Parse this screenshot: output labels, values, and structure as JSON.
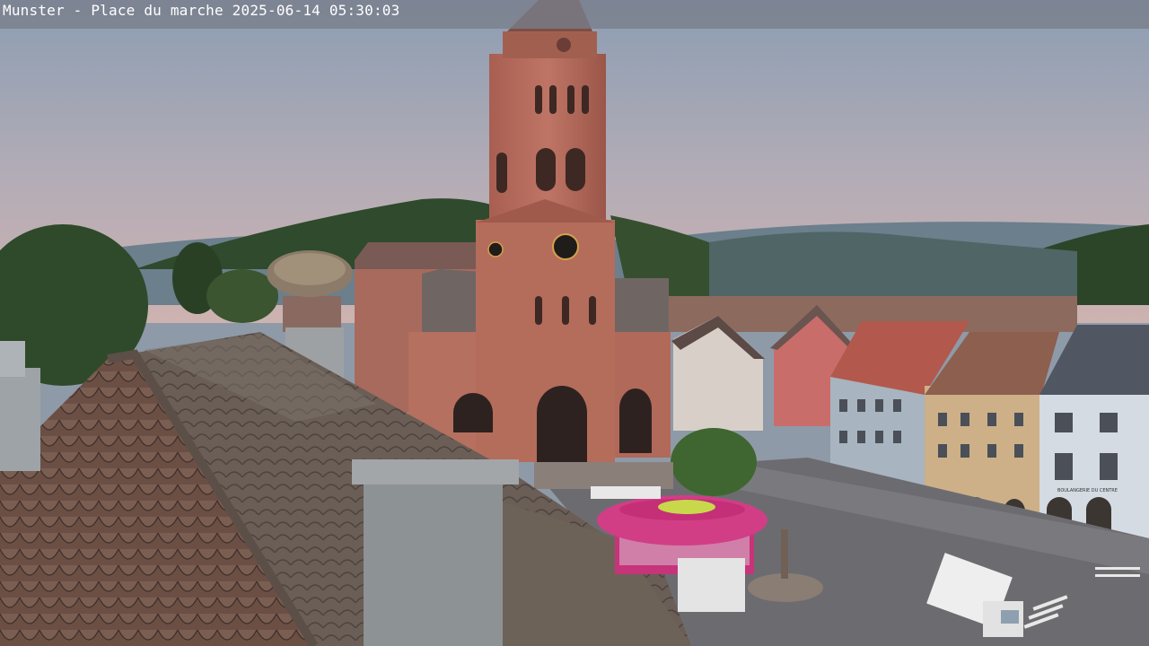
{
  "webcam": {
    "location": "Munster - Place du marche",
    "date": "2025-06-14",
    "time": "05:30:03"
  },
  "overlay": {
    "caption": "Munster - Place du marche 2025-06-14 05:30:03"
  },
  "scene": {
    "shop_sign": "BOULANGERIE DU CENTRE"
  },
  "colors": {
    "sky_top": "#8a9bb0",
    "sky_bottom": "#c9b4b4",
    "sandstone": "#b36b5a",
    "roof_tiles": "#6b5f55",
    "carousel_roof": "#d13e86",
    "hills": "#3d5a36"
  }
}
